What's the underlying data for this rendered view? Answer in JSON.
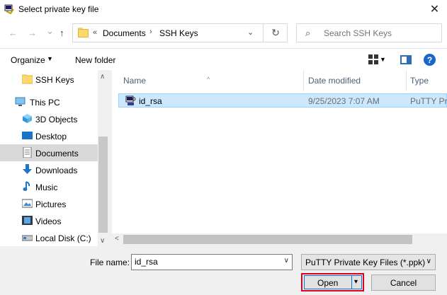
{
  "window": {
    "title": "Select private key file"
  },
  "nav": {
    "back": "←",
    "forward": "→",
    "recent": "⌄",
    "up": "↑",
    "address": {
      "chevron": "«",
      "crumbs": [
        "Documents",
        "SSH Keys"
      ],
      "separator": "›",
      "dropdown": "⌄",
      "refresh": "↻"
    },
    "search": {
      "placeholder": "Search SSH Keys",
      "icon": "⌕"
    }
  },
  "toolbar": {
    "organize": "Organize",
    "organize_caret": "▼",
    "new_folder": "New folder",
    "view_caret": "▼",
    "help": "?"
  },
  "sidebar": {
    "items": [
      {
        "label": "SSH Keys",
        "icon": "folder-icon"
      },
      {
        "label": "This PC",
        "icon": "computer-icon"
      },
      {
        "label": "3D Objects",
        "icon": "cube-icon"
      },
      {
        "label": "Desktop",
        "icon": "desktop-icon"
      },
      {
        "label": "Documents",
        "icon": "document-icon",
        "selected": true
      },
      {
        "label": "Downloads",
        "icon": "download-icon"
      },
      {
        "label": "Music",
        "icon": "music-icon"
      },
      {
        "label": "Pictures",
        "icon": "picture-icon"
      },
      {
        "label": "Videos",
        "icon": "video-icon"
      },
      {
        "label": "Local Disk (C:)",
        "icon": "disk-icon"
      }
    ],
    "scroll_up": "∧",
    "scroll_down": "∨"
  },
  "filelist": {
    "columns": [
      "Name",
      "Date modified",
      "Type"
    ],
    "sort_indicator": "^",
    "rows": [
      {
        "name": "id_rsa",
        "date": "9/25/2023 7:07 AM",
        "type": "PuTTY Priv",
        "icon": "putty-key-icon"
      }
    ],
    "hscroll_left": "<"
  },
  "footer": {
    "file_name_label": "File name:",
    "file_name_value": "id_rsa",
    "file_name_dropdown": "∨",
    "filter": "PuTTY Private Key Files (*.ppk)",
    "filter_dropdown": "∨",
    "open": "Open",
    "open_dropdown": "▾",
    "cancel": "Cancel"
  },
  "colors": {
    "selection": "#cce8ff",
    "highlight_border": "#e0001b",
    "accent": "#0078d7"
  }
}
